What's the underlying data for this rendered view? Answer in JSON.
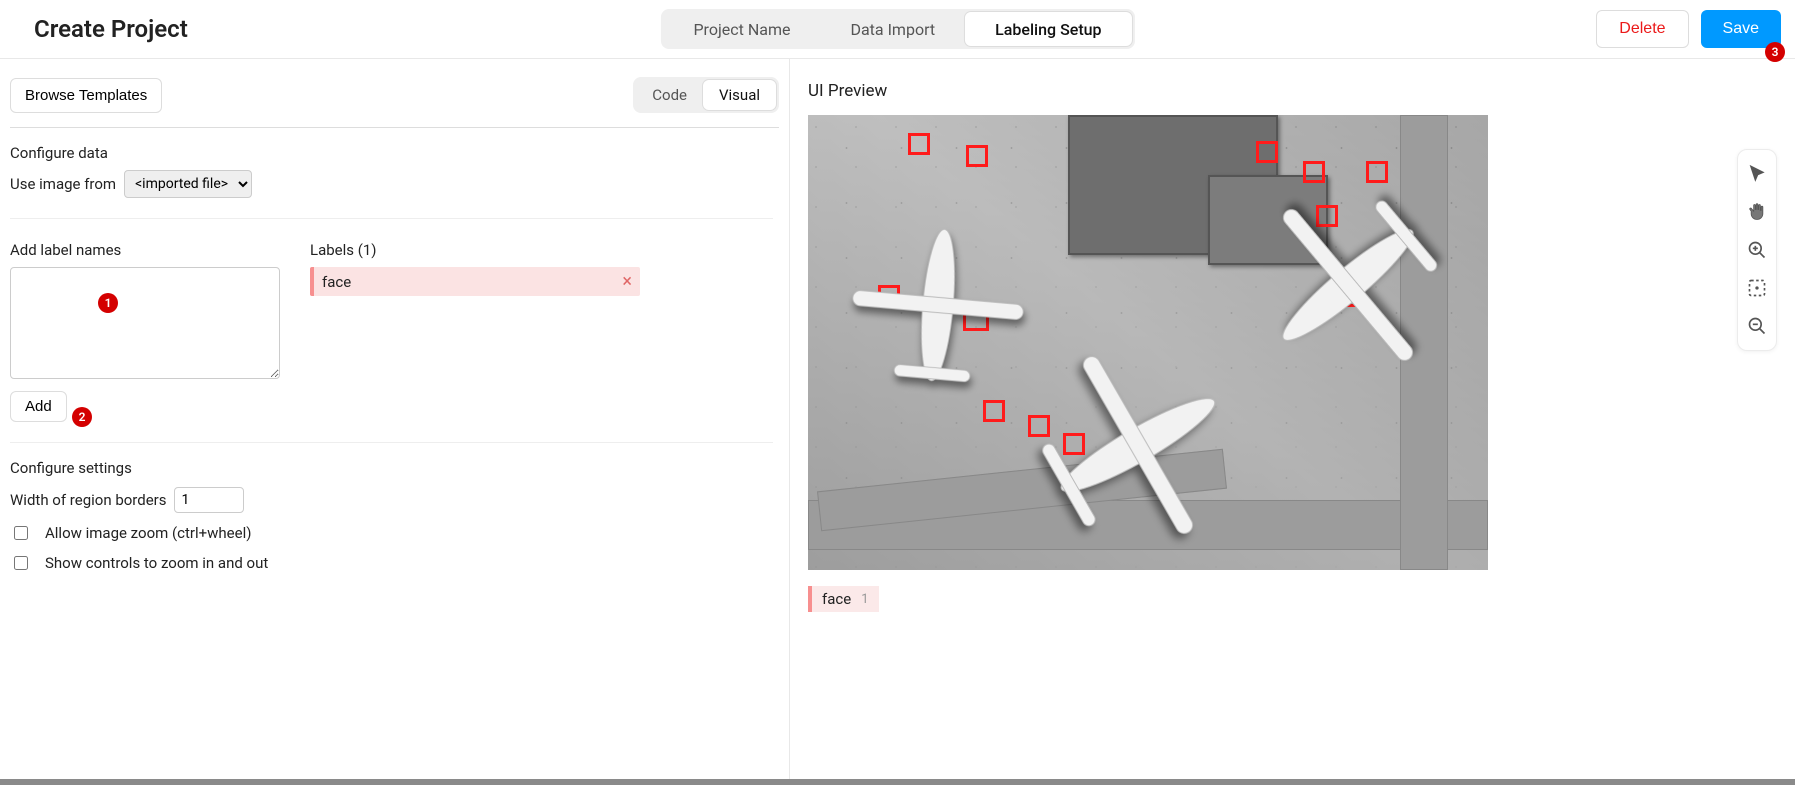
{
  "header": {
    "title": "Create Project",
    "steps": [
      "Project Name",
      "Data Import",
      "Labeling Setup"
    ],
    "active_step": 2,
    "delete_label": "Delete",
    "save_label": "Save"
  },
  "templates": {
    "browse_label": "Browse Templates",
    "code_tab": "Code",
    "visual_tab": "Visual",
    "active_tab": "Visual"
  },
  "configure_data": {
    "section": "Configure data",
    "use_image_from_label": "Use image from",
    "source_options": [
      "<imported file>"
    ],
    "selected_source": "<imported file>"
  },
  "labels": {
    "add_heading": "Add label names",
    "add_textarea_value": "",
    "add_button": "Add",
    "list_heading": "Labels (1)",
    "items": [
      {
        "name": "face"
      }
    ]
  },
  "settings": {
    "section": "Configure settings",
    "border_width_label": "Width of region borders",
    "border_width_value": "1",
    "allow_zoom_label": "Allow image zoom (ctrl+wheel)",
    "allow_zoom_checked": false,
    "show_zoom_controls_label": "Show controls to zoom in and out",
    "show_zoom_controls_checked": false
  },
  "preview": {
    "title": "UI Preview",
    "label_name": "face",
    "label_hotkey": "1",
    "tool_names": [
      "pointer",
      "pan",
      "zoom-in",
      "fullscreen",
      "zoom-out"
    ]
  },
  "tour": {
    "step1": "1",
    "step2": "2",
    "step3": "3"
  }
}
